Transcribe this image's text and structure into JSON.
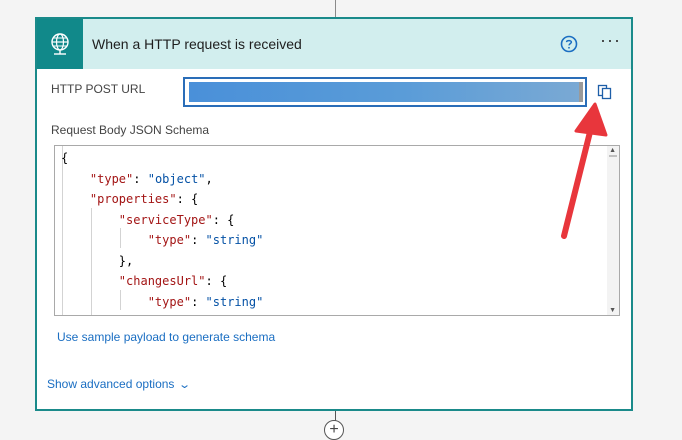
{
  "trigger": {
    "title": "When a HTTP request is received",
    "icon": "globe-icon",
    "help_icon": "help-circle-icon",
    "more_label": "···"
  },
  "fields": {
    "http_post_url_label": "HTTP POST URL",
    "schema_label": "Request Body JSON Schema",
    "copy_icon": "copy-icon"
  },
  "schema_code": [
    {
      "indent": 0,
      "parts": [
        {
          "t": "p",
          "s": "{"
        }
      ]
    },
    {
      "indent": 1,
      "parts": [
        {
          "t": "s",
          "s": "\"type\""
        },
        {
          "t": "p",
          "s": ": "
        },
        {
          "t": "v",
          "s": "\"object\""
        },
        {
          "t": "p",
          "s": ","
        }
      ]
    },
    {
      "indent": 1,
      "parts": [
        {
          "t": "s",
          "s": "\"properties\""
        },
        {
          "t": "p",
          "s": ": {"
        }
      ]
    },
    {
      "indent": 2,
      "parts": [
        {
          "t": "s",
          "s": "\"serviceType\""
        },
        {
          "t": "p",
          "s": ": {"
        }
      ]
    },
    {
      "indent": 3,
      "parts": [
        {
          "t": "s",
          "s": "\"type\""
        },
        {
          "t": "p",
          "s": ": "
        },
        {
          "t": "v",
          "s": "\"string\""
        }
      ]
    },
    {
      "indent": 2,
      "parts": [
        {
          "t": "p",
          "s": "},"
        }
      ]
    },
    {
      "indent": 2,
      "parts": [
        {
          "t": "s",
          "s": "\"changesUrl\""
        },
        {
          "t": "p",
          "s": ": {"
        }
      ]
    },
    {
      "indent": 3,
      "parts": [
        {
          "t": "s",
          "s": "\"type\""
        },
        {
          "t": "p",
          "s": ": "
        },
        {
          "t": "v",
          "s": "\"string\""
        }
      ]
    },
    {
      "indent": 2,
      "parts": [
        {
          "t": "p",
          "s": "},"
        }
      ]
    }
  ],
  "links": {
    "sample_payload": "Use sample payload to generate schema",
    "advanced_options": "Show advanced options"
  },
  "add_step_label": "+",
  "colors": {
    "header_bg": "#d2eeee",
    "icon_bg": "#11898a",
    "card_border": "#1a8a8a",
    "link": "#1a6ec2",
    "arrow": "#e8363c"
  }
}
